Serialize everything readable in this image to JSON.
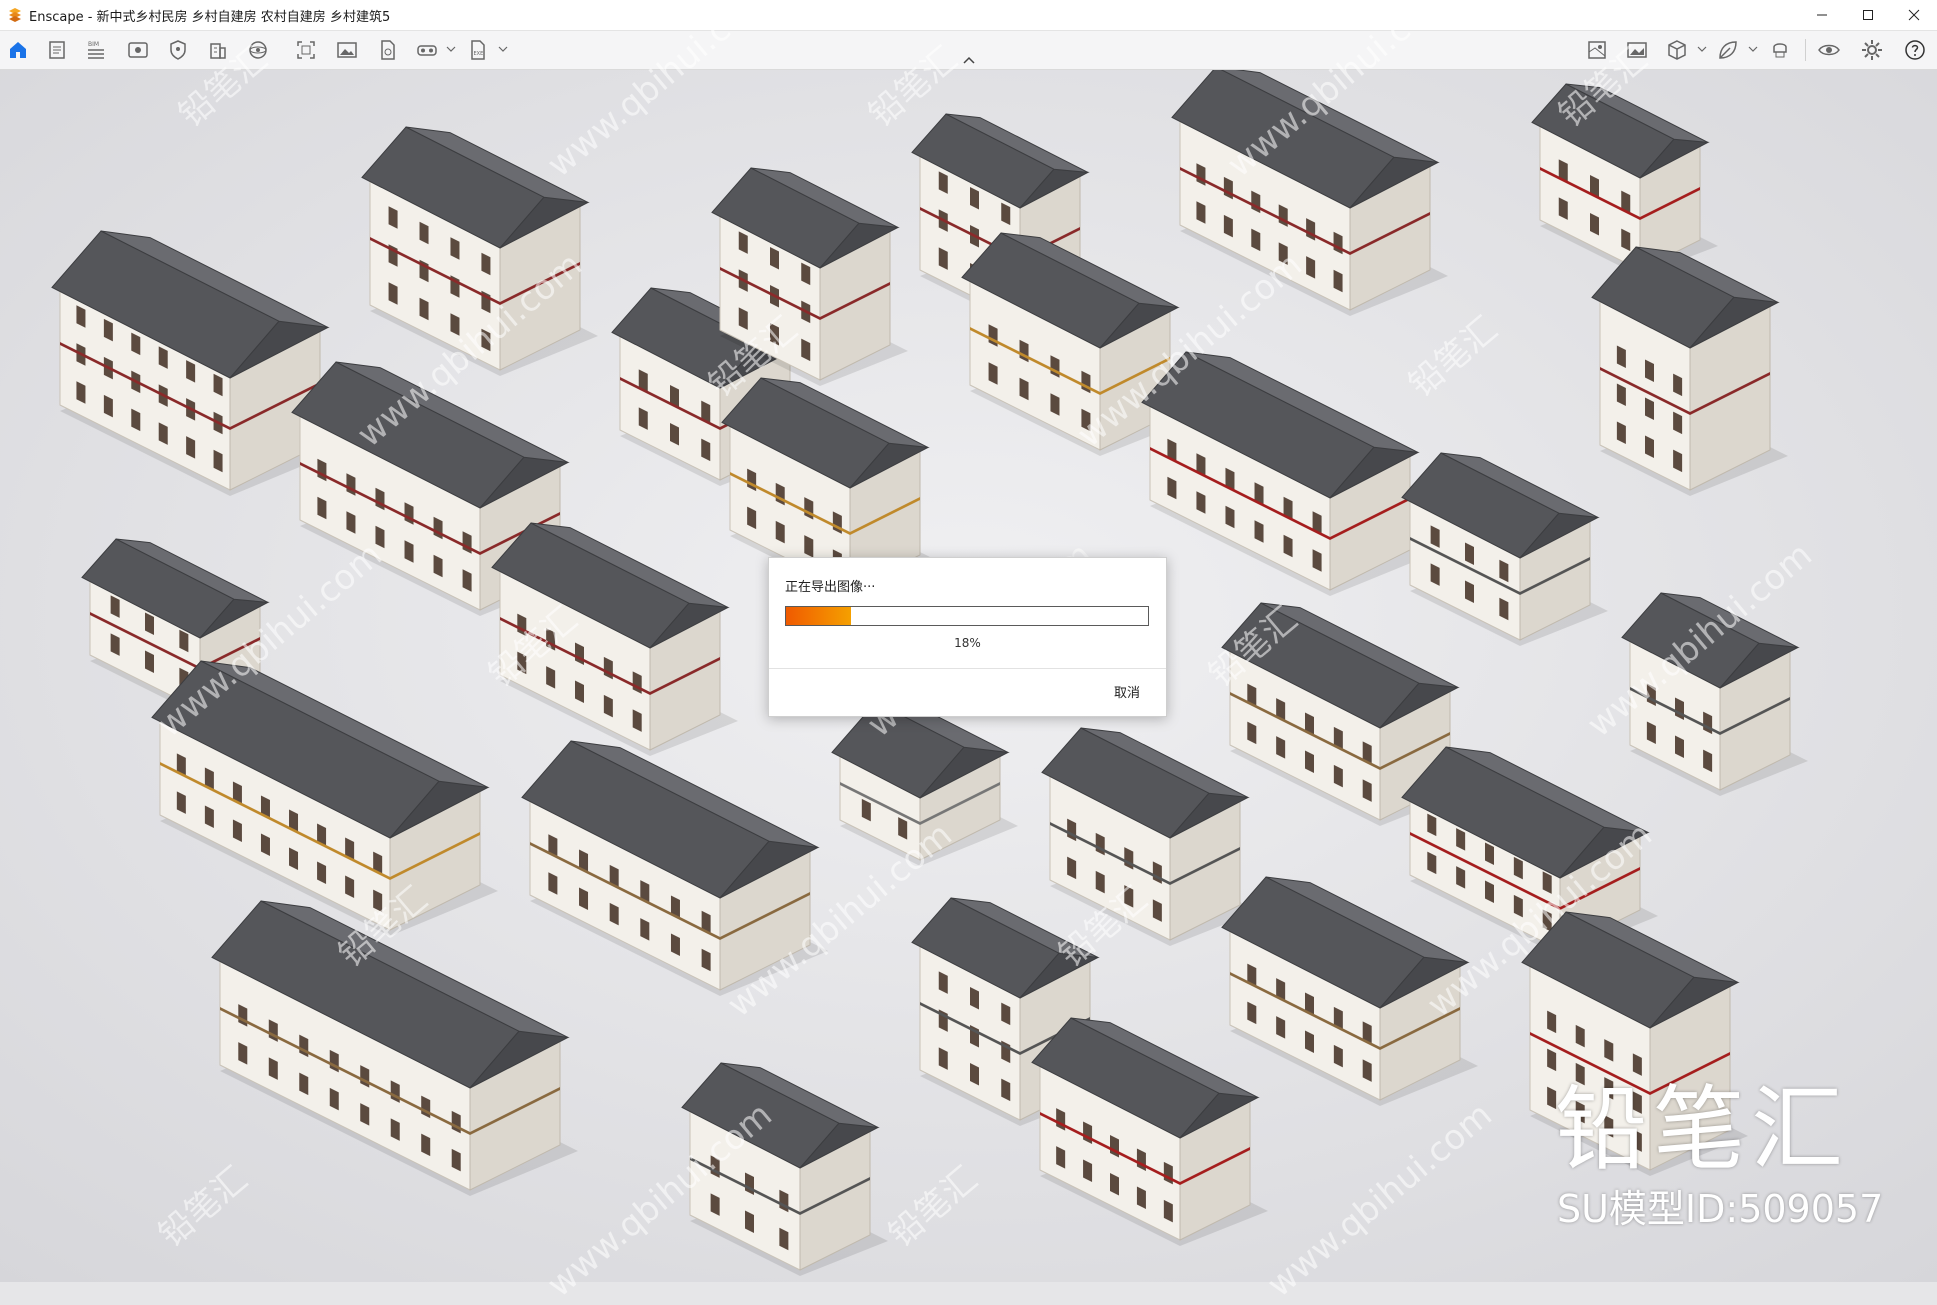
{
  "window": {
    "app_name": "Enscape",
    "title": "Enscape - 新中式乡村民房 乡村自建房 农村自建房 乡村建筑5"
  },
  "toolbar": {
    "left_tools": [
      "home-icon",
      "document-icon",
      "bim-icon",
      "view-icon",
      "shield-icon",
      "building-icon",
      "orbit-icon",
      "capture-icon",
      "image-icon",
      "render-icon",
      "vr-headset-icon",
      "export-exe-icon"
    ],
    "right_tools": [
      "map-icon",
      "gallery-icon",
      "cube-icon",
      "leaf-icon",
      "vr-icon",
      "eye-icon",
      "settings-icon",
      "help-icon"
    ]
  },
  "dialog": {
    "title": "正在导出图像···",
    "progress": 0.18,
    "progress_label": "18%",
    "cancel_label": "取消",
    "progress_color": "#f07000"
  },
  "watermark": {
    "brand": "铅笔汇",
    "model_id": "SU模型ID:509057",
    "repeated": [
      "铅笔汇",
      "www.qbihui.com"
    ]
  },
  "colors": {
    "accent_home": "#1a73e8",
    "logo": "#f5a623",
    "ground": "#e8e8ea"
  }
}
